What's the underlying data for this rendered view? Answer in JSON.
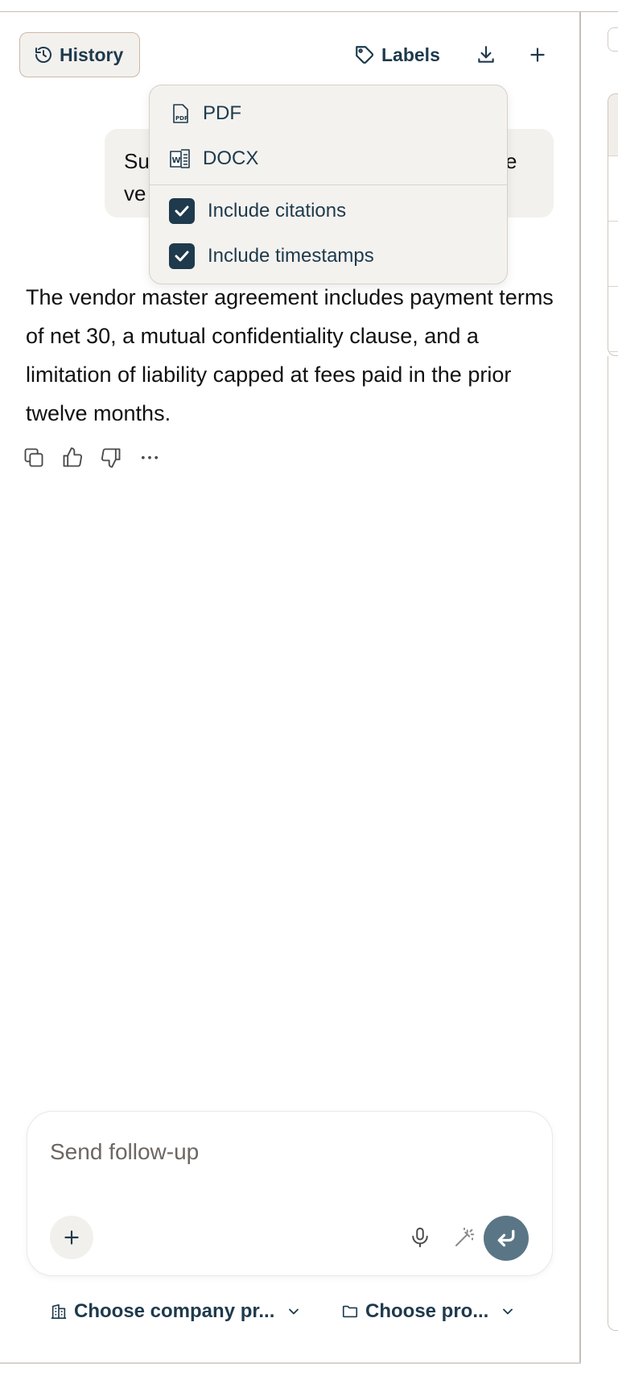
{
  "header": {
    "history_label": "History",
    "labels_label": "Labels"
  },
  "user_message": {
    "text_visible_left": "Su\nve",
    "text_visible_right": "e"
  },
  "export_menu": {
    "formats": [
      {
        "label": "PDF",
        "icon": "pdf-file-icon"
      },
      {
        "label": "DOCX",
        "icon": "word-file-icon"
      }
    ],
    "options": [
      {
        "label": "Include citations",
        "checked": true
      },
      {
        "label": "Include timestamps",
        "checked": true
      }
    ]
  },
  "assistant_message": {
    "text": "The vendor master agreement includes payment terms of net 30, a mutual confidentiality clause, and a limitation of liability capped at fees paid in the prior twelve months."
  },
  "composer": {
    "placeholder": "Send follow-up",
    "value": ""
  },
  "selectors": {
    "company_label": "Choose company pr...",
    "project_label": "Choose pro..."
  },
  "colors": {
    "accent": "#1e3a4c",
    "send_button": "#5a7686",
    "surface": "#f3f1ee",
    "border": "#c8bdb3"
  }
}
